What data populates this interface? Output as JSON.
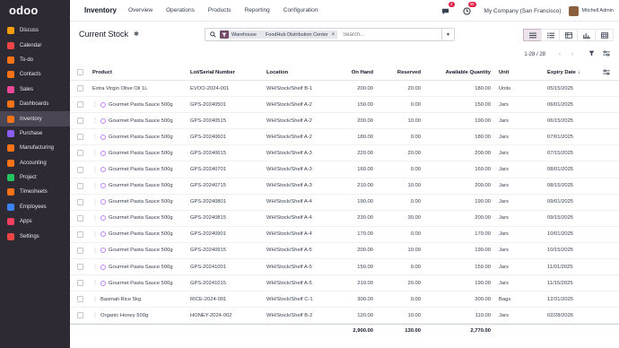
{
  "app": {
    "logo": "odoo",
    "title": "Inventory",
    "menu": [
      "Overview",
      "Operations",
      "Products",
      "Reporting",
      "Configuration"
    ],
    "activity_badge": "4",
    "clock_badge": "35",
    "company": "My Company (San Francisco)",
    "user": "Mitchell Admin"
  },
  "sidebar": {
    "items": [
      {
        "label": "Discuss",
        "color": "#f59e0b"
      },
      {
        "label": "Calendar",
        "color": "#ef4444"
      },
      {
        "label": "To-do",
        "color": "#f97316"
      },
      {
        "label": "Contacts",
        "color": "#f97316"
      },
      {
        "label": "Sales",
        "color": "#ec4899"
      },
      {
        "label": "Dashboards",
        "color": "#f97316"
      },
      {
        "label": "Inventory",
        "color": "#f97316"
      },
      {
        "label": "Purchase",
        "color": "#8b5cf6"
      },
      {
        "label": "Manufacturing",
        "color": "#f97316"
      },
      {
        "label": "Accounting",
        "color": "#f97316"
      },
      {
        "label": "Project",
        "color": "#22c55e"
      },
      {
        "label": "Timesheets",
        "color": "#f97316"
      },
      {
        "label": "Employees",
        "color": "#3b82f6"
      },
      {
        "label": "Apps",
        "color": "#f43f5e"
      },
      {
        "label": "Settings",
        "color": "#ef4444"
      }
    ],
    "active_index": 6
  },
  "control": {
    "breadcrumb": "Current Stock",
    "facet_field": "Warehouse",
    "facet_value": "FoodHub Distribution Center",
    "search_placeholder": "Search...",
    "pager": "1-28 / 28"
  },
  "table": {
    "columns": {
      "product": "Product",
      "lot": "Lot/Serial Number",
      "location": "Location",
      "onhand": "On Hand",
      "reserved": "Reserved",
      "available": "Available Quantity",
      "unit": "Unit",
      "expiry": "Expiry Date"
    },
    "rows": [
      {
        "product": "Extra Virgin Olive Oil 1L",
        "lot": "EVOO-2024-001",
        "location": "WH/Stock/Shelf B-1",
        "onhand": "200.00",
        "reserved": "20.00",
        "available": "180.00",
        "unit": "Units",
        "expiry": "05/15/2025",
        "handle": false,
        "warn": false
      },
      {
        "product": "Gourmet Pasta Sauce 500g",
        "lot": "GPS-20240501",
        "location": "WH/Stock/Shelf A-2",
        "onhand": "150.00",
        "reserved": "0.00",
        "available": "150.00",
        "unit": "Jars",
        "expiry": "06/01/2025",
        "handle": true,
        "warn": true
      },
      {
        "product": "Gourmet Pasta Sauce 500g",
        "lot": "GPS-20240515",
        "location": "WH/Stock/Shelf A-2",
        "onhand": "200.00",
        "reserved": "10.00",
        "available": "190.00",
        "unit": "Jars",
        "expiry": "06/15/2025",
        "handle": true,
        "warn": true
      },
      {
        "product": "Gourmet Pasta Sauce 500g",
        "lot": "GPS-20240601",
        "location": "WH/Stock/Shelf A-2",
        "onhand": "180.00",
        "reserved": "0.00",
        "available": "180.00",
        "unit": "Jars",
        "expiry": "07/01/2025",
        "handle": true,
        "warn": true
      },
      {
        "product": "Gourmet Pasta Sauce 500g",
        "lot": "GPS-20240615",
        "location": "WH/Stock/Shelf A-3",
        "onhand": "220.00",
        "reserved": "20.00",
        "available": "200.00",
        "unit": "Jars",
        "expiry": "07/15/2025",
        "handle": true,
        "warn": true
      },
      {
        "product": "Gourmet Pasta Sauce 500g",
        "lot": "GPS-20240701",
        "location": "WH/Stock/Shelf A-3",
        "onhand": "160.00",
        "reserved": "0.00",
        "available": "160.00",
        "unit": "Jars",
        "expiry": "08/01/2025",
        "handle": true,
        "warn": true
      },
      {
        "product": "Gourmet Pasta Sauce 500g",
        "lot": "GPS-20240715",
        "location": "WH/Stock/Shelf A-3",
        "onhand": "210.00",
        "reserved": "10.00",
        "available": "200.00",
        "unit": "Jars",
        "expiry": "08/15/2025",
        "handle": true,
        "warn": true
      },
      {
        "product": "Gourmet Pasta Sauce 500g",
        "lot": "GPS-20240801",
        "location": "WH/Stock/Shelf A-4",
        "onhand": "190.00",
        "reserved": "0.00",
        "available": "190.00",
        "unit": "Jars",
        "expiry": "09/01/2025",
        "handle": true,
        "warn": true
      },
      {
        "product": "Gourmet Pasta Sauce 500g",
        "lot": "GPS-20240815",
        "location": "WH/Stock/Shelf A-4",
        "onhand": "230.00",
        "reserved": "30.00",
        "available": "200.00",
        "unit": "Jars",
        "expiry": "09/15/2025",
        "handle": true,
        "warn": true
      },
      {
        "product": "Gourmet Pasta Sauce 500g",
        "lot": "GPS-20240901",
        "location": "WH/Stock/Shelf A-4",
        "onhand": "170.00",
        "reserved": "0.00",
        "available": "170.00",
        "unit": "Jars",
        "expiry": "10/01/2025",
        "handle": true,
        "warn": true
      },
      {
        "product": "Gourmet Pasta Sauce 500g",
        "lot": "GPS-20240915",
        "location": "WH/Stock/Shelf A-5",
        "onhand": "200.00",
        "reserved": "10.00",
        "available": "190.00",
        "unit": "Jars",
        "expiry": "10/15/2025",
        "handle": true,
        "warn": true
      },
      {
        "product": "Gourmet Pasta Sauce 500g",
        "lot": "GPS-20241001",
        "location": "WH/Stock/Shelf A-5",
        "onhand": "150.00",
        "reserved": "0.00",
        "available": "150.00",
        "unit": "Jars",
        "expiry": "11/01/2025",
        "handle": true,
        "warn": true
      },
      {
        "product": "Gourmet Pasta Sauce 500g",
        "lot": "GPS-20241015",
        "location": "WH/Stock/Shelf A-5",
        "onhand": "210.00",
        "reserved": "20.00",
        "available": "190.00",
        "unit": "Jars",
        "expiry": "11/15/2025",
        "handle": true,
        "warn": true
      },
      {
        "product": "Basmati Rice 5kg",
        "lot": "RICE-2024-001",
        "location": "WH/Stock/Shelf C-1",
        "onhand": "300.00",
        "reserved": "0.00",
        "available": "300.00",
        "unit": "Bags",
        "expiry": "12/31/2025",
        "handle": true,
        "warn": false
      },
      {
        "product": "Organic Honey 500g",
        "lot": "HONEY-2024-002",
        "location": "WH/Stock/Shelf B-2",
        "onhand": "120.00",
        "reserved": "10.00",
        "available": "110.00",
        "unit": "Jars",
        "expiry": "02/28/2026",
        "handle": true,
        "warn": false
      }
    ],
    "totals": {
      "onhand": "2,900.00",
      "reserved": "130.00",
      "available": "2,770.00"
    }
  }
}
